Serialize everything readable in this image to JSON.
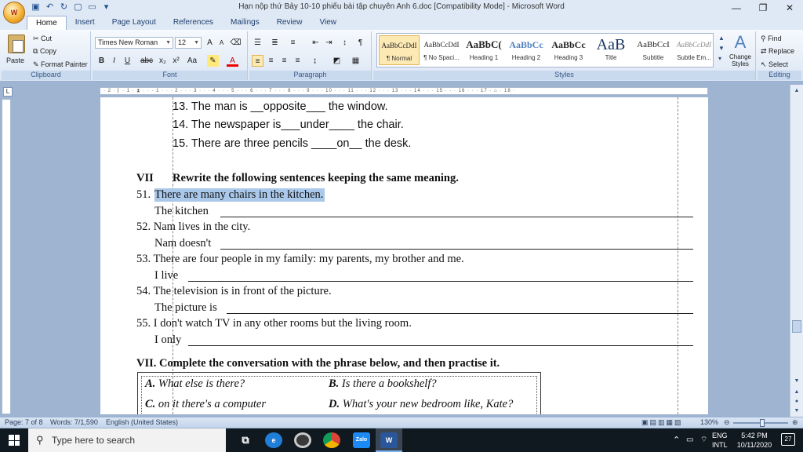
{
  "window": {
    "title": "Hạn nộp thứ Bảy 10-10 phiếu bài tập chuyên Anh 6.doc [Compatibility Mode] - Microsoft Word",
    "minimize": "—",
    "maximize": "❐",
    "close": "✕"
  },
  "tabs": [
    "Home",
    "Insert",
    "Page Layout",
    "References",
    "Mailings",
    "Review",
    "View"
  ],
  "clipboard": {
    "paste": "Paste",
    "cut": "Cut",
    "copy": "Copy",
    "format_painter": "Format Painter",
    "label": "Clipboard"
  },
  "font": {
    "name": "Times New Roman",
    "size": "12",
    "label": "Font"
  },
  "paragraph": {
    "label": "Paragraph"
  },
  "styles": {
    "label": "Styles",
    "items": [
      {
        "sample": "AaBbCcDdI",
        "name": "¶ Normal"
      },
      {
        "sample": "AaBbCcDdI",
        "name": "¶ No Spaci..."
      },
      {
        "sample": "AaBbC(",
        "name": "Heading 1"
      },
      {
        "sample": "AaBbCc",
        "name": "Heading 2"
      },
      {
        "sample": "AaBbCc",
        "name": "Heading 3"
      },
      {
        "sample": "AaB",
        "name": "Title"
      },
      {
        "sample": "AaBbCcI",
        "name": "Subtitle"
      },
      {
        "sample": "AaBbCcDdI",
        "name": "Subtle Em..."
      }
    ],
    "change_styles": "Change Styles"
  },
  "editing": {
    "find": "Find",
    "replace": "Replace",
    "select": "Select",
    "label": "Editing"
  },
  "document": {
    "list_items": [
      "13. The man is __opposite___ the window.",
      "14. The newspaper is___under____ the chair.",
      "15. There are three pencils ____on__ the desk."
    ],
    "section_vii_num": "VII",
    "section_vii_title": "Rewrite the following sentences keeping the same meaning.",
    "q51_num": "51.",
    "q51_text": "There are many chairs in the kitchen.",
    "q51_start": "The kitchen",
    "q52": "52. Nam lives in the city.",
    "q52_start": "Nam doesn't",
    "q53": "53. There are four people in my family: my parents, my brother and me.",
    "q53_start": "I live",
    "q54": "54. The television is in front of the picture.",
    "q54_start": "The picture is",
    "q55": "55. I don't watch TV in any other rooms but the living room.",
    "q55_start": "I only",
    "section_vii2_title": "VII. Complete the conversation with the phrase below, and then practise it.",
    "options": {
      "a_letter": "A.",
      "a_text": " What else is there?",
      "b_letter": "B.",
      "b_text": " Is there a bookshelf?",
      "c_letter": "C.",
      "c_text": " on it there's a computer",
      "d_letter": "D.",
      "d_text": " What's your new bedroom like, Kate?"
    }
  },
  "status": {
    "page": "Page: 7 of 8",
    "words": "Words: 7/1,590",
    "language": "English (United States)",
    "zoom": "130%"
  },
  "taskbar": {
    "search_placeholder": "Type here to search",
    "lang_top": "ENG",
    "lang_bottom": "INTL",
    "time": "5:42 PM",
    "date": "10/11/2020",
    "notifications": "27"
  }
}
